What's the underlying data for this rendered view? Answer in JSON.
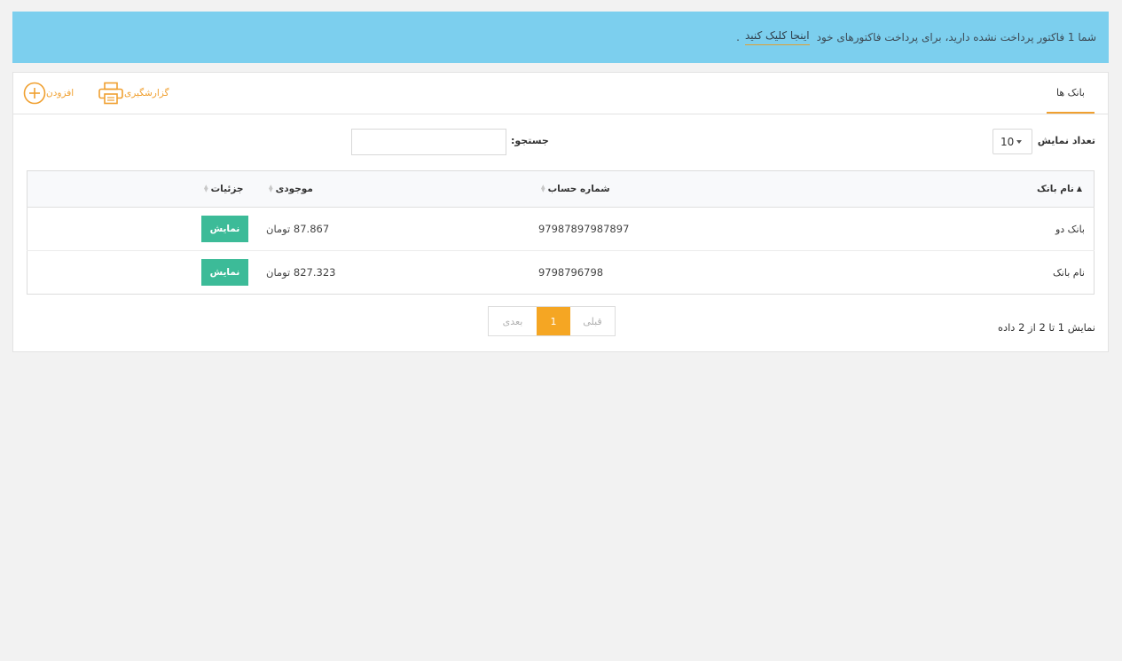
{
  "alert": {
    "message": "شما 1 فاکتور پرداخت نشده دارید، برای پرداخت فاکتورهای خود",
    "link_text": "اینجا کلیک کنید",
    "suffix": "."
  },
  "header": {
    "tab_label": "بانک ها",
    "report_label": "گزارشگیری",
    "add_label": "افزودن"
  },
  "controls": {
    "length_label": "تعداد نمایش",
    "length_value": "10",
    "search_label": "جستجو:",
    "search_value": ""
  },
  "table": {
    "columns": [
      "نام بانک",
      "شماره حساب",
      "موجودی",
      "جزئیات"
    ],
    "rows": [
      {
        "name": "بانک دو",
        "account": "97987897987897",
        "balance": "87.867 تومان",
        "action": "نمایش"
      },
      {
        "name": "نام بانک",
        "account": "9798796798",
        "balance": "827.323 تومان",
        "action": "نمایش"
      }
    ]
  },
  "footer": {
    "info": "نمایش 1 تا 2 از 2 داده",
    "prev_label": "قبلی",
    "current_page": "1",
    "next_label": "بعدی"
  },
  "colors": {
    "alert_bg": "#7ccfee",
    "accent": "#f0a030",
    "action_button": "#3cbb98",
    "page_active": "#f5a623"
  },
  "icons": {
    "report": "printer-icon",
    "add": "plus-circle-icon",
    "sort_asc": "sort-asc-icon",
    "sort_both": "sort-icon"
  }
}
